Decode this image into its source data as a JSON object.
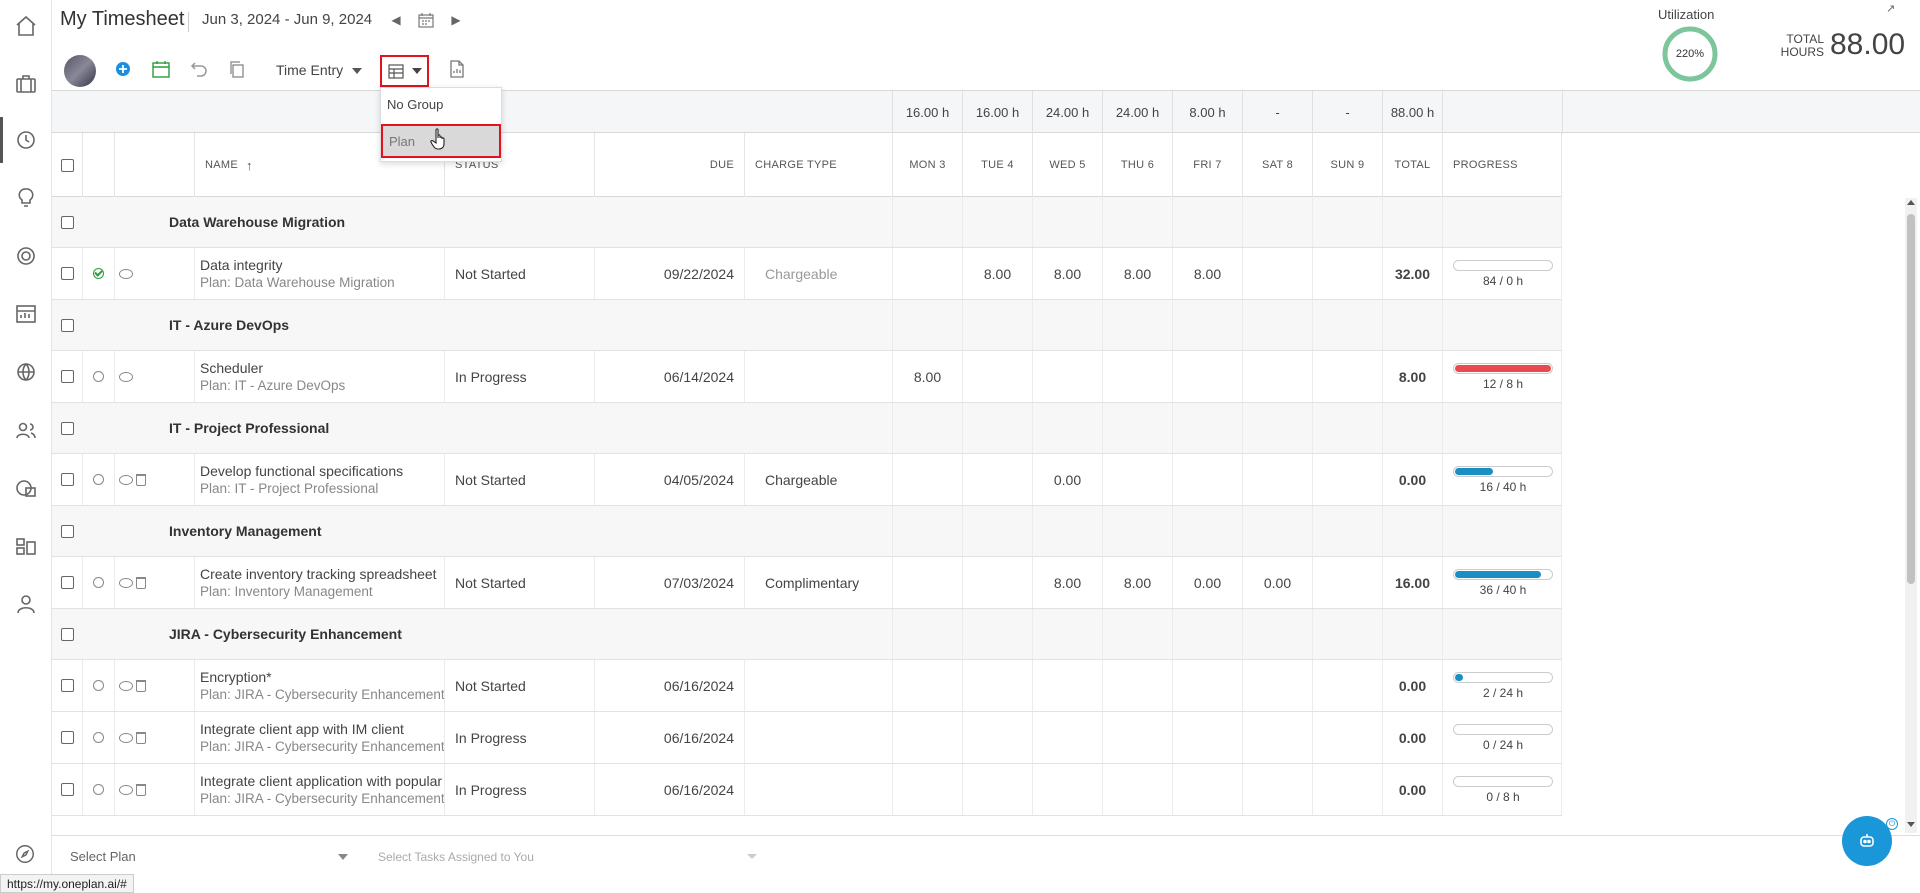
{
  "header": {
    "title": "My Timesheet",
    "date_range": "Jun 3, 2024 - Jun 9, 2024",
    "utilization_label": "Utilization",
    "utilization_value": "220%",
    "total_hours_label": "TOTAL HOURS",
    "total_hours_value": "88.00"
  },
  "toolbar": {
    "time_entry_label": "Time Entry"
  },
  "group_dropdown": {
    "items": [
      {
        "label": "No Group"
      },
      {
        "label": "Plan"
      }
    ],
    "selected": "Plan"
  },
  "summary_row": [
    "16.00 h",
    "16.00 h",
    "24.00 h",
    "24.00 h",
    "8.00 h",
    "-",
    "-",
    "88.00 h"
  ],
  "columns": {
    "name": "NAME",
    "status": "STATUS",
    "due": "DUE",
    "charge_type": "CHARGE TYPE",
    "days": [
      "MON 3",
      "TUE 4",
      "WED 5",
      "THU 6",
      "FRI 7",
      "SAT 8",
      "SUN 9"
    ],
    "total": "TOTAL",
    "progress": "PROGRESS"
  },
  "rows": [
    {
      "type": "group",
      "title": "Data Warehouse Migration"
    },
    {
      "type": "task",
      "name": "Data integrity",
      "plan": "Plan: Data Warehouse Migration",
      "status": "Not Started",
      "due": "09/22/2024",
      "charge": "Chargeable",
      "days": [
        "",
        "8.00",
        "8.00",
        "8.00",
        "8.00",
        "",
        ""
      ],
      "total": "32.00",
      "progress_text": "84 / 0 h",
      "progress": 0,
      "progress_color": "#1a8fc4"
    },
    {
      "type": "group",
      "title": "IT - Azure DevOps"
    },
    {
      "type": "task",
      "name": "Scheduler",
      "plan": "Plan: IT - Azure DevOps",
      "status": "In Progress",
      "due": "06/14/2024",
      "charge": "",
      "days": [
        "8.00",
        "",
        "",
        "",
        "",
        "",
        ""
      ],
      "total": "8.00",
      "progress_text": "12 / 8 h",
      "progress": 1.0,
      "progress_color": "#e84a4f"
    },
    {
      "type": "group",
      "title": "IT - Project Professional"
    },
    {
      "type": "task",
      "name": "Develop functional specifications",
      "plan": "Plan: IT - Project Professional",
      "status": "Not Started",
      "due": "04/05/2024",
      "charge": "Chargeable",
      "days": [
        "",
        "",
        "0.00",
        "",
        "",
        "",
        ""
      ],
      "total": "0.00",
      "progress_text": "16 / 40 h",
      "progress": 0.4,
      "progress_color": "#1a8fc4"
    },
    {
      "type": "group",
      "title": "Inventory Management"
    },
    {
      "type": "task",
      "name": "Create inventory tracking spreadsheet",
      "plan": "Plan: Inventory Management",
      "status": "Not Started",
      "due": "07/03/2024",
      "charge": "Complimentary",
      "days": [
        "",
        "",
        "8.00",
        "8.00",
        "0.00",
        "0.00",
        ""
      ],
      "total": "16.00",
      "progress_text": "36 / 40 h",
      "progress": 0.9,
      "progress_color": "#1a8fc4"
    },
    {
      "type": "group",
      "title": "JIRA - Cybersecurity Enhancement"
    },
    {
      "type": "task",
      "name": "Encryption*",
      "plan": "Plan: JIRA - Cybersecurity Enhancement",
      "status": "Not Started",
      "due": "06/16/2024",
      "charge": "",
      "days": [
        "",
        "",
        "",
        "",
        "",
        "",
        ""
      ],
      "total": "0.00",
      "progress_text": "2 / 24 h",
      "progress": 0.08,
      "progress_color": "#1a8fc4"
    },
    {
      "type": "task",
      "name": "Integrate client app with IM client",
      "plan": "Plan: JIRA - Cybersecurity Enhancement",
      "status": "In Progress",
      "due": "06/16/2024",
      "charge": "",
      "days": [
        "",
        "",
        "",
        "",
        "",
        "",
        ""
      ],
      "total": "0.00",
      "progress_text": "0 / 24 h",
      "progress": 0,
      "progress_color": "#1a8fc4"
    },
    {
      "type": "task",
      "name": "Integrate client application with popular",
      "plan": "Plan: JIRA - Cybersecurity Enhancement",
      "status": "In Progress",
      "due": "06/16/2024",
      "charge": "",
      "days": [
        "",
        "",
        "",
        "",
        "",
        "",
        ""
      ],
      "total": "0.00",
      "progress_text": "0 / 8 h",
      "progress": 0,
      "progress_color": "#1a8fc4"
    }
  ],
  "footer": {
    "select_plan_placeholder": "Select Plan",
    "select_tasks_placeholder": "Select Tasks Assigned to You",
    "status_url": "https://my.oneplan.ai/#"
  }
}
